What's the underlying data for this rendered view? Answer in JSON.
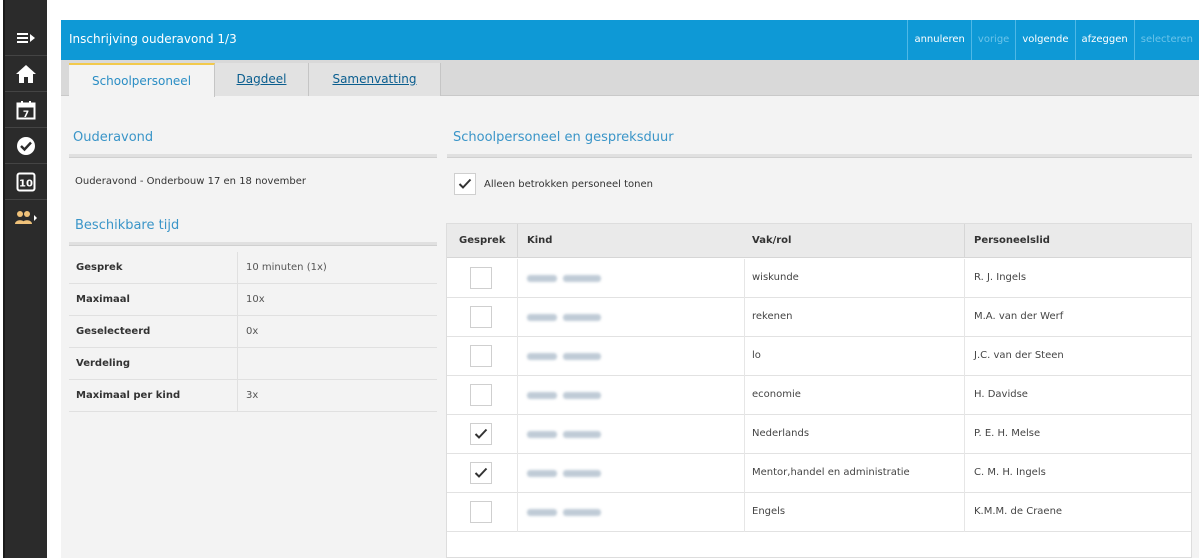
{
  "rail": {
    "items": [
      {
        "icon": "menu-toggle-icon"
      },
      {
        "icon": "home-icon"
      },
      {
        "icon": "calendar-icon"
      },
      {
        "icon": "check-circle-icon"
      },
      {
        "icon": "grades-10-icon",
        "text": "10"
      },
      {
        "icon": "people-icon"
      }
    ]
  },
  "header": {
    "title": "Inschrijving ouderavond 1/3",
    "actions": [
      {
        "label": "annuleren",
        "enabled": true
      },
      {
        "label": "vorige",
        "enabled": false
      },
      {
        "label": "volgende",
        "enabled": true
      },
      {
        "label": "afzeggen",
        "enabled": true
      },
      {
        "label": "selecteren",
        "enabled": false
      }
    ]
  },
  "tabs": [
    {
      "label": "Schoolpersoneel",
      "active": true
    },
    {
      "label": "Dagdeel",
      "active": false
    },
    {
      "label": "Samenvatting",
      "active": false
    }
  ],
  "left": {
    "ouderavond_title": "Ouderavond",
    "ouderavond_name": "Ouderavond - Onderbouw 17 en 18 november",
    "beschikbaar_title": "Beschikbare tijd",
    "info": [
      {
        "label": "Gesprek",
        "value": "10 minuten (1x)"
      },
      {
        "label": "Maximaal",
        "value": "10x"
      },
      {
        "label": "Geselecteerd",
        "value": "0x"
      },
      {
        "label": "Verdeling",
        "value": ""
      },
      {
        "label": "Maximaal per kind",
        "value": "3x"
      }
    ]
  },
  "right": {
    "title": "Schoolpersoneel en gespreksduur",
    "filter_label": "Alleen betrokken personeel tonen",
    "filter_checked": true,
    "columns": [
      "Gesprek",
      "Kind",
      "Vak/rol",
      "Personeelslid"
    ],
    "rows": [
      {
        "checked": false,
        "vak": "wiskunde",
        "personeel": "R. J. Ingels"
      },
      {
        "checked": false,
        "vak": "rekenen",
        "personeel": "M.A. van der Werf"
      },
      {
        "checked": false,
        "vak": "lo",
        "personeel": "J.C. van der Steen"
      },
      {
        "checked": false,
        "vak": "economie",
        "personeel": "H. Davidse"
      },
      {
        "checked": true,
        "vak": "Nederlands",
        "personeel": "P. E. H. Melse"
      },
      {
        "checked": true,
        "vak": "Mentor,handel en administratie",
        "personeel": "C. M. H. Ingels"
      },
      {
        "checked": false,
        "vak": "Engels",
        "personeel": "K.M.M. de Craene"
      }
    ]
  },
  "colors": {
    "header_blue": "#0e99d6",
    "rail": "#2b2b2b",
    "section_title": "#3a95c8",
    "tab_accent": "#f2c94c"
  }
}
